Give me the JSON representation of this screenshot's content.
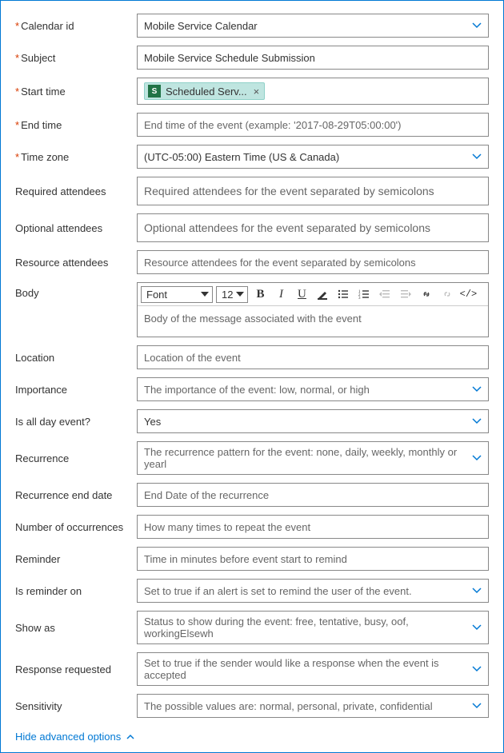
{
  "labels": {
    "calendar_id": "Calendar id",
    "subject": "Subject",
    "start_time": "Start time",
    "end_time": "End time",
    "time_zone": "Time zone",
    "required_attendees": "Required attendees",
    "optional_attendees": "Optional attendees",
    "resource_attendees": "Resource attendees",
    "body": "Body",
    "location": "Location",
    "importance": "Importance",
    "is_all_day": "Is all day event?",
    "recurrence": "Recurrence",
    "recurrence_end": "Recurrence end date",
    "num_occurrences": "Number of occurrences",
    "reminder": "Reminder",
    "is_reminder_on": "Is reminder on",
    "show_as": "Show as",
    "response_requested": "Response requested",
    "sensitivity": "Sensitivity"
  },
  "values": {
    "calendar_id": "Mobile Service Calendar",
    "subject": "Mobile Service Schedule Submission",
    "start_time_token": "Scheduled Serv...",
    "time_zone": "(UTC-05:00) Eastern Time (US & Canada)",
    "is_all_day": "Yes"
  },
  "placeholders": {
    "end_time": "End time of the event (example: '2017-08-29T05:00:00')",
    "required_attendees": "Required attendees for the event separated by semicolons",
    "optional_attendees": "Optional attendees for the event separated by semicolons",
    "resource_attendees": "Resource attendees for the event separated by semicolons",
    "body": "Body of the message associated with the event",
    "location": "Location of the event",
    "importance": "The importance of the event: low, normal, or high",
    "recurrence": "The recurrence pattern for the event: none, daily, weekly, monthly or yearl",
    "recurrence_end": "End Date of the recurrence",
    "num_occurrences": "How many times to repeat the event",
    "reminder": "Time in minutes before event start to remind",
    "is_reminder_on": "Set to true if an alert is set to remind the user of the event.",
    "show_as": "Status to show during the event: free, tentative, busy, oof, workingElsewh",
    "response_requested": "Set to true if the sender would like a response when the event is accepted",
    "sensitivity": "The possible values are: normal, personal, private, confidential"
  },
  "toolbar": {
    "font": "Font",
    "size": "12"
  },
  "footer": {
    "hide_advanced": "Hide advanced options"
  }
}
